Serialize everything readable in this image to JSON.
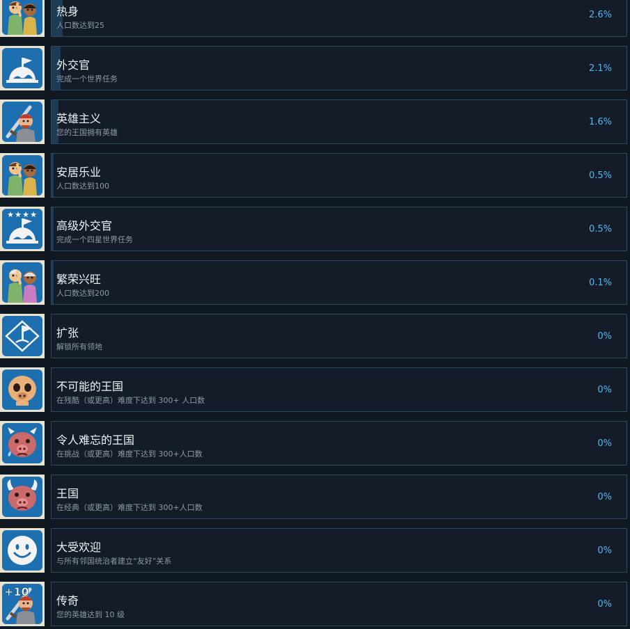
{
  "achievements": [
    {
      "title": "热身",
      "description": "人口数达到25",
      "percent_text": "2.6%",
      "percent": 2.6,
      "icon": "two-villagers-icon"
    },
    {
      "title": "外交官",
      "description": "完成一个世界任务",
      "percent_text": "2.1%",
      "percent": 2.1,
      "icon": "flag-globe-icon"
    },
    {
      "title": "英雄主义",
      "description": "您的王国拥有英雄",
      "percent_text": "1.6%",
      "percent": 1.6,
      "icon": "hero-sword-icon"
    },
    {
      "title": "安居乐业",
      "description": "人口数达到100",
      "percent_text": "0.5%",
      "percent": 0.5,
      "icon": "two-villagers-icon"
    },
    {
      "title": "高级外交官",
      "description": "完成一个四星世界任务",
      "percent_text": "0.5%",
      "percent": 0.5,
      "icon": "four-star-flag-globe-icon"
    },
    {
      "title": "繁荣兴旺",
      "description": "人口数达到200",
      "percent_text": "0.1%",
      "percent": 0.1,
      "icon": "elder-villagers-icon"
    },
    {
      "title": "扩张",
      "description": "解锁所有领地",
      "percent_text": "0%",
      "percent": 0,
      "icon": "flag-map-icon"
    },
    {
      "title": "不可能的王国",
      "description": "在残酷（或更高）难度下达到 300+ 人口数",
      "percent_text": "0%",
      "percent": 0,
      "icon": "skull-pig-icon"
    },
    {
      "title": "令人难忘的王国",
      "description": "在挑战（或更高）难度下达到 300+人口数",
      "percent_text": "0%",
      "percent": 0,
      "icon": "crying-pig-icon"
    },
    {
      "title": "王国",
      "description": "在经典（或更高）难度下达到 300+人口数",
      "percent_text": "0%",
      "percent": 0,
      "icon": "viking-pig-icon"
    },
    {
      "title": "大受欢迎",
      "description": "与所有邻国统治者建立“友好”关系",
      "percent_text": "0%",
      "percent": 0,
      "icon": "smiley-face-icon"
    },
    {
      "title": "传奇",
      "description": "您的英雄达到 10 级",
      "percent_text": "0%",
      "percent": 0,
      "icon": "hero-level-up-icon"
    }
  ]
}
